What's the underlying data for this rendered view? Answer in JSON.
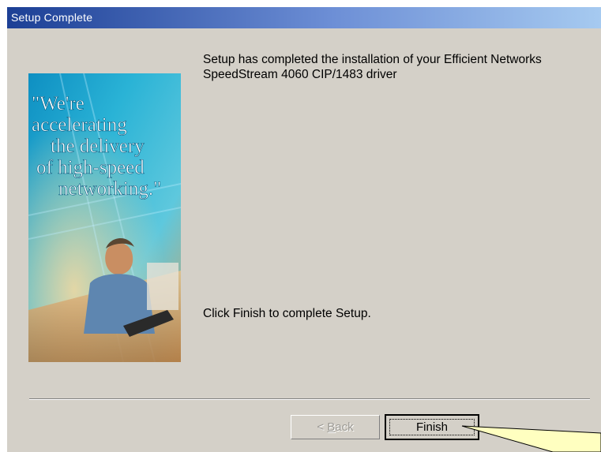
{
  "window": {
    "title": "Setup Complete"
  },
  "banner": {
    "quote_lines": [
      "\"We're",
      "accelerating",
      "the delivery",
      "of high-speed",
      "networking.\""
    ]
  },
  "content": {
    "message_line1": "Setup has completed the installation of your Efficient Networks",
    "message_line2": "SpeedStream 4060 CIP/1483 driver",
    "instruction": "Click Finish to complete Setup."
  },
  "buttons": {
    "back_prefix": "< ",
    "back_key": "B",
    "back_rest": "ack",
    "back_enabled": false,
    "finish": "Finish"
  },
  "colors": {
    "dialog_bg": "#d4d0c8",
    "titlebar_start": "#1c3f95",
    "titlebar_end": "#a6caf0",
    "banner_teal": "#2ab3d6",
    "callout_fill": "#ffffc0"
  }
}
